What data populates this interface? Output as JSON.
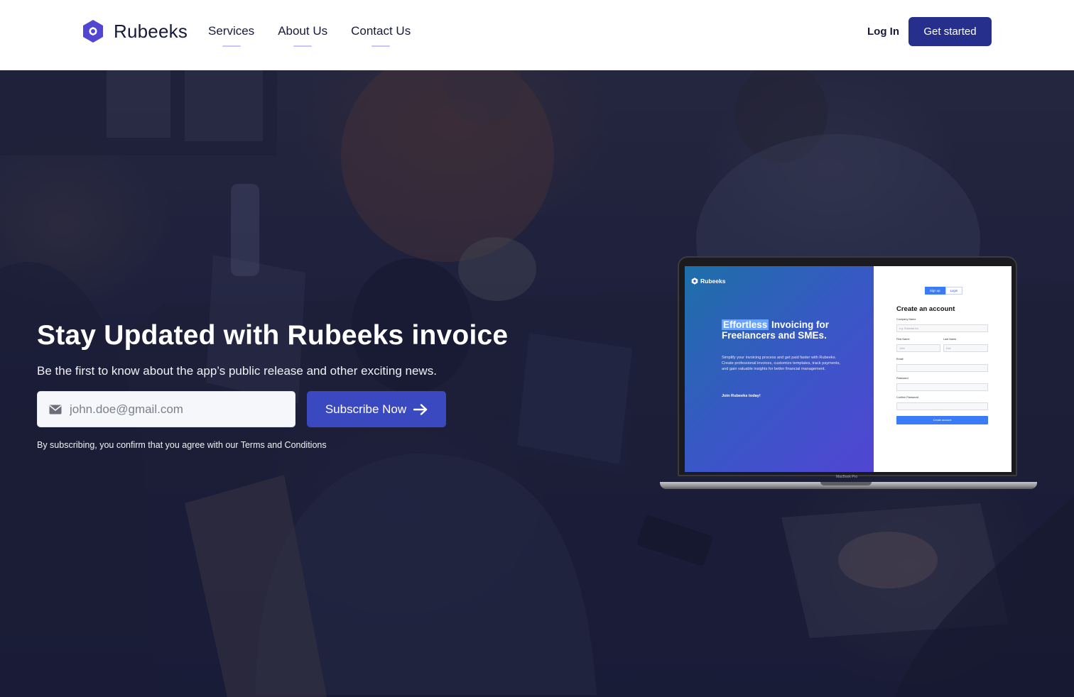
{
  "brand": {
    "name": "Rubeeks",
    "logo_icon": "hexagon-logo-icon",
    "color": "#5145d2"
  },
  "nav": {
    "links": [
      {
        "label": "Services"
      },
      {
        "label": "About Us"
      },
      {
        "label": "Contact Us"
      }
    ],
    "login_label": "Log In",
    "cta_label": "Get started"
  },
  "hero": {
    "title": "Stay Updated with Rubeeks invoice",
    "subtitle": "Be the first to know about the app’s public release and other exciting news.",
    "email_placeholder": "john.doe@gmail.com",
    "email_icon": "mail-icon",
    "subscribe_label": "Subscribe Now",
    "subscribe_icon": "arrow-right-icon",
    "terms": "By subscribing, you confirm that you agree with our Terms and Conditions"
  },
  "laptop": {
    "brand": "Rubeeks",
    "headline_highlight": "Effortless",
    "headline_line1_rest": " Invoicing for",
    "headline_line2": "Freelancers and SMEs.",
    "body": "Simplify your invoicing process and get paid faster with Rubeeks. Create professional invoices, customize templates, track payments, and gain valuable insights for better financial management.",
    "join": "Join Rubeeks today!",
    "tab_signup": "Sign up",
    "tab_login": "Login",
    "form_title": "Create an account",
    "company_label": "Company Name",
    "company_placeholder": "e.g. Rubeeks Inc.",
    "first_label": "First Name",
    "first_placeholder": "John",
    "last_label": "Last Name",
    "last_placeholder": "Doe",
    "email_label": "Email",
    "password_label": "Password",
    "confirm_label": "Confirm Password",
    "create_btn": "Create account",
    "model": "MacBook Pro"
  },
  "colors": {
    "navy_button": "#262f8c",
    "subscribe_button": "#3a49c0",
    "text_dark": "#161a3a",
    "overlay": "#12163a"
  }
}
